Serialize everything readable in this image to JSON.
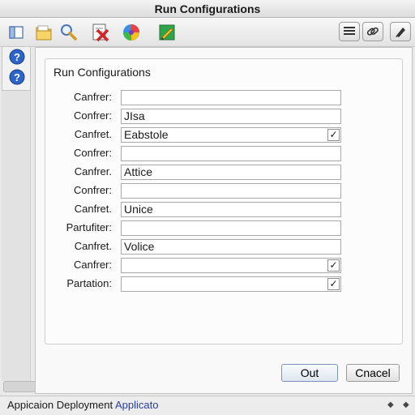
{
  "window": {
    "title": "Run Configurations"
  },
  "toolbar": {
    "icons": [
      "folder-icon",
      "search-icon",
      "delete-icon",
      "color-wheel-icon",
      "edit-icon"
    ],
    "right_icons": [
      "list-icon",
      "link-icon",
      "pen-icon"
    ]
  },
  "sidebar": {
    "icons": [
      "sidebar-icon",
      "help-icon",
      "help-icon"
    ]
  },
  "group": {
    "title": "Run Configurations",
    "fields": [
      {
        "label": "Canfrer:",
        "value": "",
        "checkbox": false
      },
      {
        "label": "Confrer:",
        "value": "JIsa",
        "checkbox": false
      },
      {
        "label": "Canfret.",
        "value": "Eabstole",
        "checkbox": true
      },
      {
        "label": "Confrer:",
        "value": "",
        "checkbox": false
      },
      {
        "label": "Canfrer.",
        "value": "Attice",
        "checkbox": false
      },
      {
        "label": "Confrer:",
        "value": "",
        "checkbox": false
      },
      {
        "label": "Canfret.",
        "value": "Unice",
        "checkbox": false
      },
      {
        "label": "Partufiter:",
        "value": "",
        "checkbox": false
      },
      {
        "label": "Canfret.",
        "value": "Volice",
        "checkbox": false
      },
      {
        "label": "Canfrer:",
        "value": "",
        "checkbox": true
      },
      {
        "label": "Partation:",
        "value": "",
        "checkbox": true
      }
    ]
  },
  "buttons": {
    "ok": "Out",
    "cancel": "Cnacel"
  },
  "status": {
    "text": "Appicaion Deployment",
    "link": "Applicato"
  },
  "colors": {
    "accent": "#2a3fa8",
    "button_border": "#7a93b8"
  }
}
